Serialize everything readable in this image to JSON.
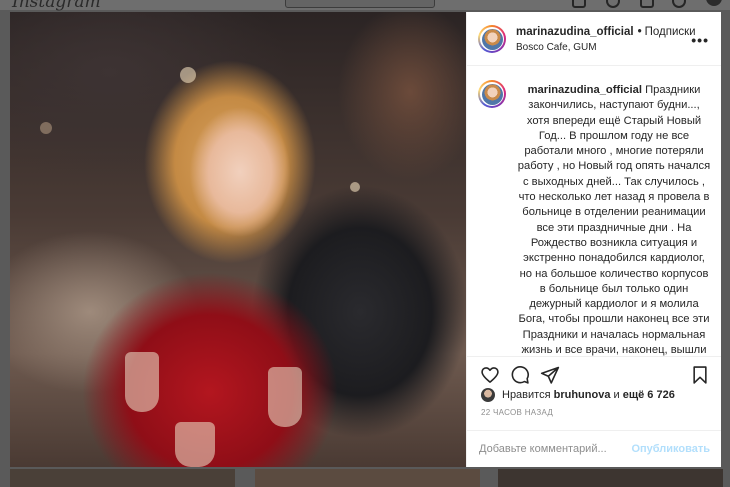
{
  "background": {
    "logo": "Instagram"
  },
  "header": {
    "username": "marinazudina_official",
    "follow_label": "Подписки",
    "location": "Bosco Cafe, GUM",
    "more_label": "•••"
  },
  "caption": {
    "username": "marinazudina_official",
    "text": "Праздники закончились, наступают будни..., хотя впереди ещё Старый Новый Год... В прошлом году не все работали много , многие потеряли работу , но Новый год опять начался с выходных дней... Так случилось , что несколько лет назад я провела в больнице в отделении реанимации все эти праздничные дни . На Рождество возникла ситуация и экстренно понадобился кардиолог, но на большое количество корпусов в больнице был только один дежурный кардиолог и я молила Бога, чтобы прошли наконец все эти Праздники и началась нормальная жизнь и все врачи, наконец, вышли на работу ... И именно в Праздничные дни люди чаще"
  },
  "likes": {
    "prefix": "Нравится",
    "liker": "bruhunova",
    "and_label": "и",
    "others": "ещё 6 726"
  },
  "timestamp": "22 ЧАСОВ НАЗАД",
  "comment": {
    "placeholder": "Добавьте комментарий...",
    "publish_label": "Опубликовать"
  },
  "icons": [
    "heart-icon",
    "comment-icon",
    "share-icon",
    "bookmark-icon",
    "more-icon"
  ],
  "colors": {
    "text": "#262626",
    "muted": "#8e8e8e",
    "publish_disabled": "#b2dffc"
  }
}
